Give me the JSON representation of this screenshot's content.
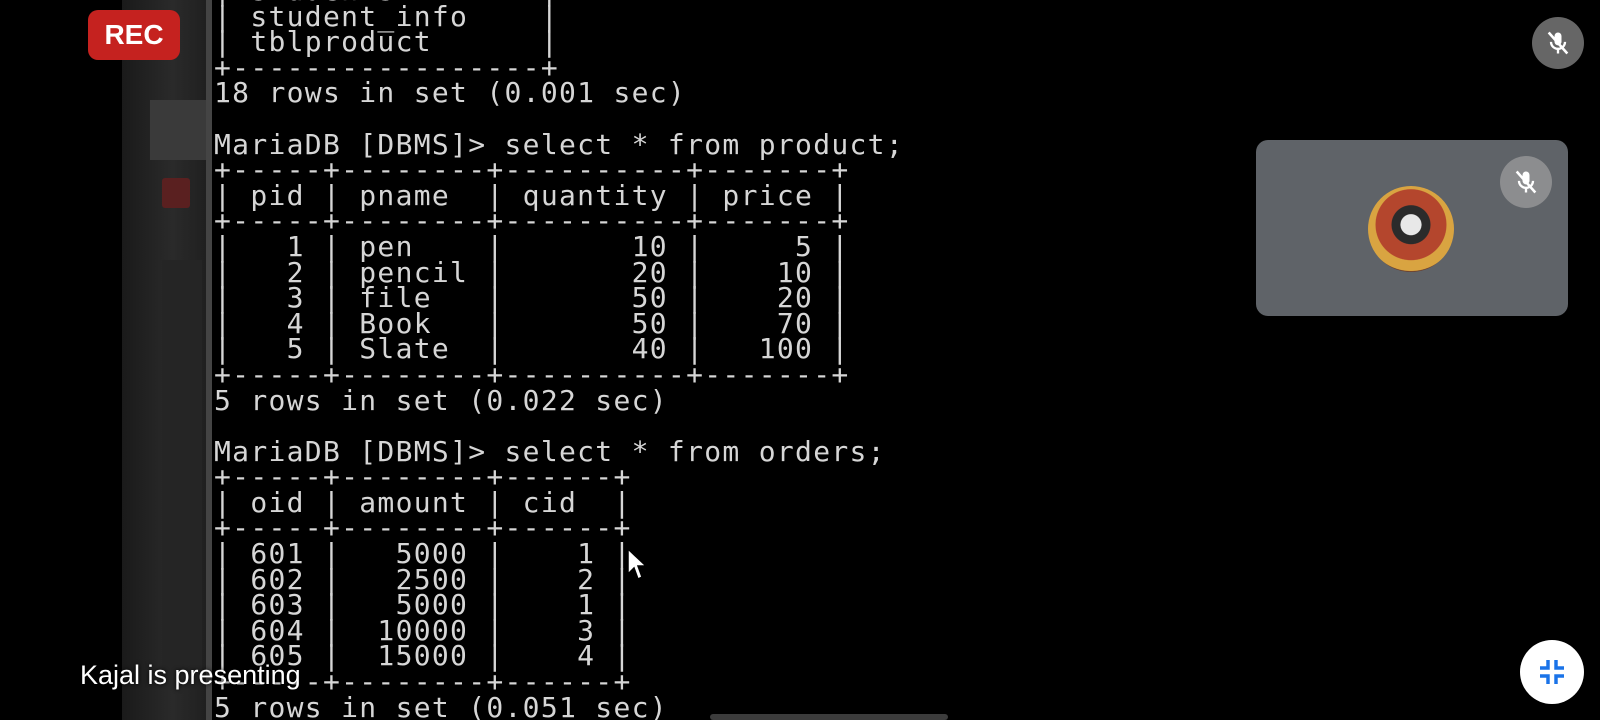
{
  "meeting": {
    "rec_label": "REC",
    "presenter_text": "Kajal is presenting",
    "mic_top_icon": "mic-off-icon",
    "self_tile_mic_icon": "mic-off-icon",
    "collapse_icon": "exit-fullscreen-icon",
    "colors": {
      "rec_bg": "#c5221f",
      "tile_bg": "#5f6368",
      "terminal_text": "#d6d6d6"
    }
  },
  "terminal": {
    "lines": [
      "| students        |",
      "| student_info    |",
      "| tblproduct      |",
      "+-----------------+",
      "18 rows in set (0.001 sec)",
      "",
      "MariaDB [DBMS]> select * from product;",
      "+-----+--------+----------+-------+",
      "| pid | pname  | quantity | price |",
      "+-----+--------+----------+-------+",
      "|   1 | pen    |       10 |     5 |",
      "|   2 | pencil |       20 |    10 |",
      "|   3 | file   |       50 |    20 |",
      "|   4 | Book   |       50 |    70 |",
      "|   5 | Slate  |       40 |   100 |",
      "+-----+--------+----------+-------+",
      "5 rows in set (0.022 sec)",
      "",
      "MariaDB [DBMS]> select * from orders;",
      "+-----+--------+------+",
      "| oid | amount | cid  |",
      "+-----+--------+------+",
      "| 601 |   5000 |    1 |",
      "| 602 |   2500 |    2 |",
      "| 603 |   5000 |    1 |",
      "| 604 |  10000 |    3 |",
      "| 605 |  15000 |    4 |",
      "+-----+--------+------+",
      "5 rows in set (0.051 sec)"
    ]
  }
}
